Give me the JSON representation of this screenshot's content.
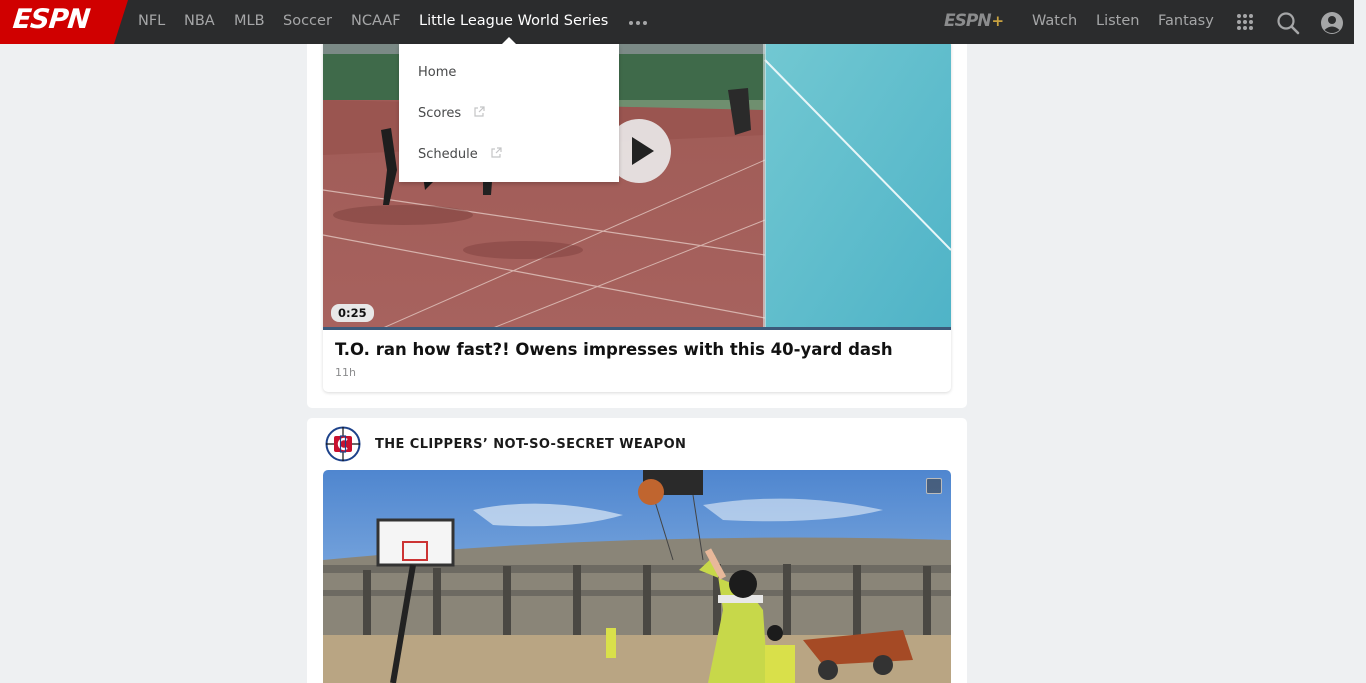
{
  "nav": {
    "logo": "ESPN",
    "items": [
      "NFL",
      "NBA",
      "MLB",
      "Soccer",
      "NCAAF",
      "Little League World Series"
    ],
    "more_icon": "more-dots-icon",
    "espn_plus": "ESPN",
    "espn_plus_suffix": "+",
    "right_items": [
      "Watch",
      "Listen",
      "Fantasy"
    ],
    "icons": [
      "apps-grid-icon",
      "search-icon",
      "profile-icon"
    ],
    "colors": {
      "bar": "#2b2c2d",
      "brand_red": "#d00000",
      "plus_gold": "#c8a240"
    }
  },
  "dropdown": {
    "items": [
      {
        "label": "Home",
        "external": false
      },
      {
        "label": "Scores",
        "external": true
      },
      {
        "label": "Schedule",
        "external": true
      }
    ]
  },
  "video_card": {
    "duration": "0:25",
    "headline": "T.O. ran how fast?! Owens impresses with this 40-yard dash",
    "age": "11h"
  },
  "section": {
    "title": "THE CLIPPERS’ NOT-SO-SECRET WEAPON",
    "icon": "clippers-logo-icon"
  }
}
